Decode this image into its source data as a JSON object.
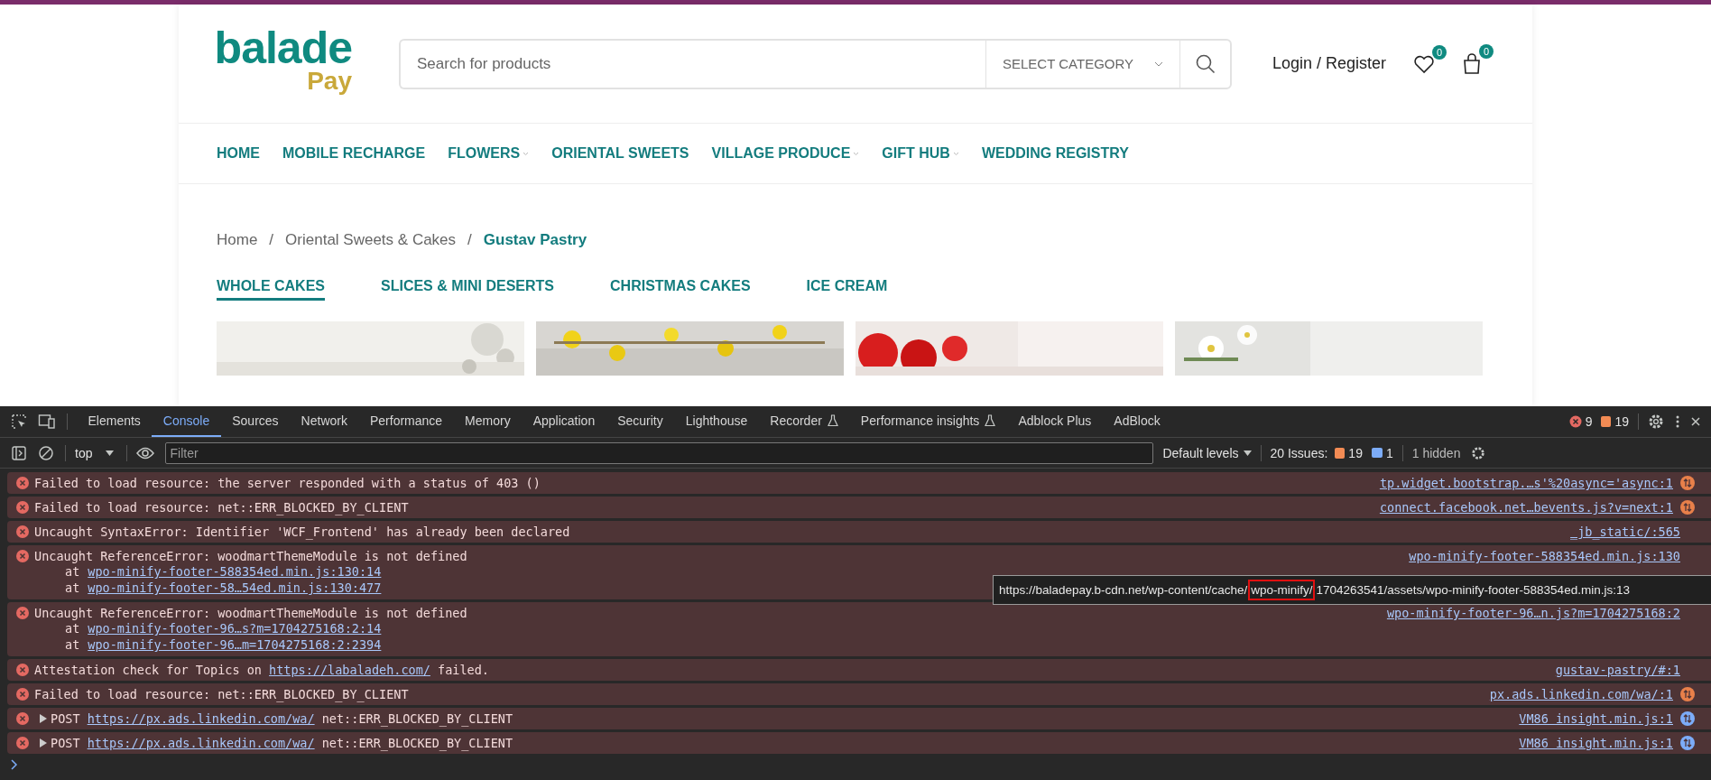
{
  "site": {
    "logo": {
      "main": "balade",
      "sub": "Pay"
    },
    "search": {
      "placeholder": "Search for products",
      "category": "SELECT CATEGORY"
    },
    "account_link": "Login / Register",
    "wishlist_count": "0",
    "cart_count": "0",
    "nav": [
      {
        "label": "HOME",
        "has_menu": false
      },
      {
        "label": "MOBILE RECHARGE",
        "has_menu": false
      },
      {
        "label": "FLOWERS",
        "has_menu": true
      },
      {
        "label": "ORIENTAL SWEETS",
        "has_menu": false
      },
      {
        "label": "VILLAGE PRODUCE",
        "has_menu": true
      },
      {
        "label": "GIFT HUB",
        "has_menu": true
      },
      {
        "label": "WEDDING REGISTRY",
        "has_menu": false
      }
    ],
    "breadcrumb": [
      "Home",
      "Oriental Sweets & Cakes",
      "Gustav Pastry"
    ],
    "breadcrumb_separator": "/",
    "subcategories": [
      {
        "label": "WHOLE CAKES",
        "selected": true
      },
      {
        "label": "SLICES & MINI DESERTS",
        "selected": false
      },
      {
        "label": "CHRISTMAS CAKES",
        "selected": false
      },
      {
        "label": "ICE CREAM",
        "selected": false
      }
    ],
    "products": [
      {
        "kind": "picture"
      },
      {
        "kind": "picture"
      },
      {
        "kind": "picture"
      },
      {
        "kind": "picture"
      }
    ]
  },
  "devtools": {
    "tabs": [
      {
        "label": "Elements",
        "selected": false,
        "experimental": false
      },
      {
        "label": "Console",
        "selected": true,
        "experimental": false
      },
      {
        "label": "Sources",
        "selected": false,
        "experimental": false
      },
      {
        "label": "Network",
        "selected": false,
        "experimental": false
      },
      {
        "label": "Performance",
        "selected": false,
        "experimental": false
      },
      {
        "label": "Memory",
        "selected": false,
        "experimental": false
      },
      {
        "label": "Application",
        "selected": false,
        "experimental": false
      },
      {
        "label": "Security",
        "selected": false,
        "experimental": false
      },
      {
        "label": "Lighthouse",
        "selected": false,
        "experimental": false
      },
      {
        "label": "Recorder",
        "selected": false,
        "experimental": true
      },
      {
        "label": "Performance insights",
        "selected": false,
        "experimental": true
      },
      {
        "label": "Adblock Plus",
        "selected": false,
        "experimental": false
      },
      {
        "label": "AdBlock",
        "selected": false,
        "experimental": false
      }
    ],
    "error_count": "9",
    "warning_count": "19",
    "context": "top",
    "filter_placeholder": "Filter",
    "levels": "Default levels",
    "issues_label": "20 Issues:",
    "issues_warnings": "19",
    "issues_info": "1",
    "hidden": "1 hidden",
    "messages": [
      {
        "expandable": false,
        "parts": [
          {
            "text": "Failed to load resource: the server responded with a status of 403 ()",
            "link": false
          }
        ],
        "source": "tp.widget.bootstrap.…s'%20async='async:1",
        "network_icon": {
          "color": "#e8804a"
        }
      },
      {
        "expandable": false,
        "parts": [
          {
            "text": "Failed to load resource: net::ERR_BLOCKED_BY_CLIENT",
            "link": false
          }
        ],
        "source": "connect.facebook.net…bevents.js?v=next:1",
        "network_icon": {
          "color": "#e8804a"
        }
      },
      {
        "expandable": false,
        "parts": [
          {
            "text": "Uncaught SyntaxError: Identifier 'WCF_Frontend' has already been declared",
            "link": false
          }
        ],
        "source": "_jb_static/:565"
      },
      {
        "expandable": false,
        "parts": [
          {
            "text": "Uncaught ReferenceError: woodmartThemeModule is not defined",
            "link": false
          }
        ],
        "stack": [
          {
            "at": "at",
            "link": "wpo-minify-footer-588354ed.min.js:130:14"
          },
          {
            "at": "at",
            "link": "wpo-minify-footer-58…54ed.min.js:130:477"
          }
        ],
        "source": "wpo-minify-footer-588354ed.min.js:130"
      },
      {
        "expandable": false,
        "parts": [
          {
            "text": "Uncaught ReferenceError: woodmartThemeModule is not defined",
            "link": false
          }
        ],
        "stack": [
          {
            "at": "at",
            "link": "wpo-minify-footer-96…s?m=1704275168:2:14"
          },
          {
            "at": "at",
            "link": "wpo-minify-footer-96…m=1704275168:2:2394"
          }
        ],
        "source": "wpo-minify-footer-96…n.js?m=1704275168:2"
      },
      {
        "expandable": false,
        "parts": [
          {
            "text": "Attestation check for Topics on ",
            "link": false
          },
          {
            "text": "https://labaladeh.com/",
            "link": true
          },
          {
            "text": " failed.",
            "link": false
          }
        ],
        "source": "gustav-pastry/#:1"
      },
      {
        "expandable": false,
        "parts": [
          {
            "text": "Failed to load resource: net::ERR_BLOCKED_BY_CLIENT",
            "link": false
          }
        ],
        "source": "px.ads.linkedin.com/wa/:1",
        "network_icon": {
          "color": "#e8804a"
        }
      },
      {
        "expandable": true,
        "parts": [
          {
            "text": "POST ",
            "link": false
          },
          {
            "text": "https://px.ads.linkedin.com/wa/",
            "link": true
          },
          {
            "text": " net::ERR_BLOCKED_BY_CLIENT",
            "link": false
          }
        ],
        "source": "VM86 insight.min.js:1",
        "network_icon": {
          "color": "#7cacf8"
        }
      },
      {
        "expandable": true,
        "parts": [
          {
            "text": "POST ",
            "link": false
          },
          {
            "text": "https://px.ads.linkedin.com/wa/",
            "link": true
          },
          {
            "text": " net::ERR_BLOCKED_BY_CLIENT",
            "link": false
          }
        ],
        "source": "VM86 insight.min.js:1",
        "network_icon": {
          "color": "#7cacf8"
        }
      }
    ],
    "tooltip": {
      "before": "https://baladepay.b-cdn.net/wp-content/cache/",
      "highlighted": "wpo-minify/",
      "after": "1704263541/assets/wpo-minify-footer-588354ed.min.js:13"
    }
  }
}
